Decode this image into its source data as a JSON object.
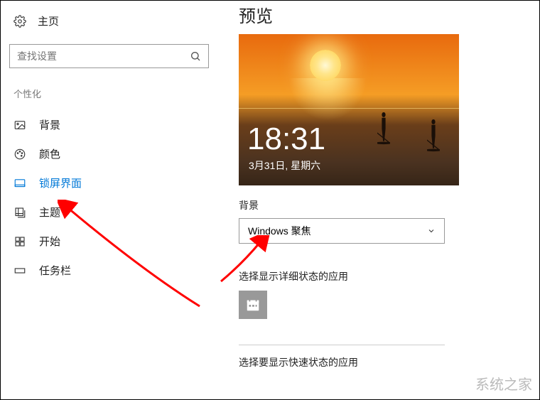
{
  "sidebar": {
    "home": "主页",
    "search_placeholder": "查找设置",
    "section": "个性化",
    "items": [
      {
        "label": "背景"
      },
      {
        "label": "颜色"
      },
      {
        "label": "锁屏界面"
      },
      {
        "label": "主题"
      },
      {
        "label": "开始"
      },
      {
        "label": "任务栏"
      }
    ]
  },
  "main": {
    "title": "预览",
    "preview": {
      "time": "18:31",
      "date": "3月31日, 星期六"
    },
    "bg_label": "背景",
    "bg_dropdown": "Windows 聚焦",
    "detail_label": "选择显示详细状态的应用",
    "quick_label": "选择要显示快速状态的应用"
  },
  "watermark": "系统之家"
}
